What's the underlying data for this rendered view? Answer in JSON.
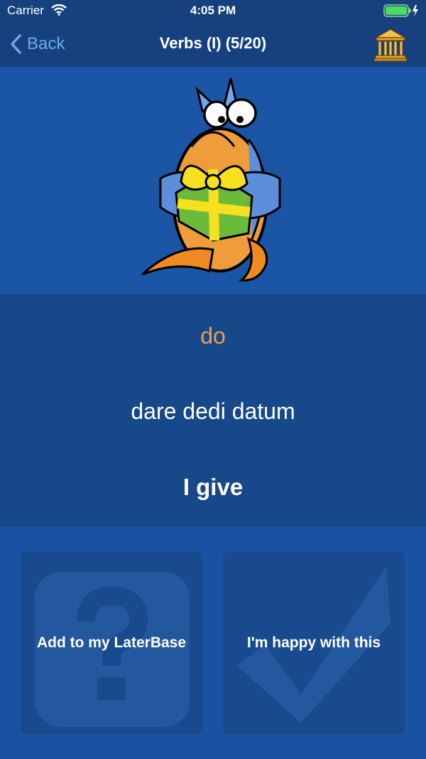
{
  "status_bar": {
    "carrier": "Carrier",
    "time": "4:05 PM"
  },
  "nav": {
    "back_label": "Back",
    "title": "Verbs (I) (5/20)"
  },
  "card": {
    "latin": "do",
    "forms": "dare dedi datum",
    "meaning": "I give"
  },
  "actions": {
    "later_label": "Add to my LaterBase",
    "happy_label": "I'm happy with this"
  },
  "colors": {
    "latin_word": "#f0a050",
    "back_link": "#6fa8f0",
    "background": "#1a52a3"
  }
}
